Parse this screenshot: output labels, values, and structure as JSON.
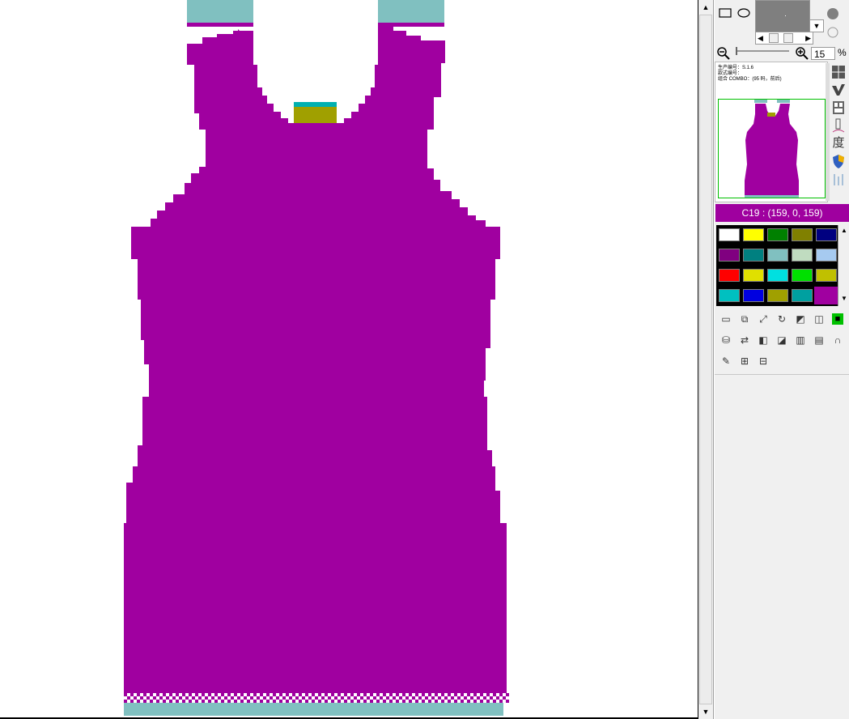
{
  "status": {
    "color_readout": "C19 : (159, 0, 159)"
  },
  "zoom": {
    "value": "15",
    "unit": "%"
  },
  "thumbnail": {
    "info_lines": [
      "生产编号：S.1.6",
      "款式编号：",
      "组合  COMBO：(95 码，前后)"
    ]
  },
  "colors": {
    "garment": "#a000a0",
    "collar_band": "#80c0c0",
    "hem_band": "#80c0c0",
    "neck_label_top": "#00b0b0",
    "neck_label": "#a0a000",
    "selected_color": "#9f009f"
  },
  "palette": [
    "#ffffff",
    "#ffff00",
    "#008000",
    "#808000",
    "#000080",
    "#800080",
    "#008080",
    "#80c0c0",
    "#c0dcc0",
    "#a6caf0",
    "#ff0000",
    "#e0e000",
    "#00e0e0",
    "#00e000",
    "#c0c000",
    "#00c0c0",
    "#0000e0",
    "#a0a000",
    "#00a0a0",
    "#a000a0"
  ],
  "side_tools": [
    "grid-icon",
    "check-icon",
    "layout-icon",
    "pen-icon",
    "du-char",
    "shield-icon",
    "bars-icon"
  ],
  "side_du_char": "度",
  "tools": [
    "select-rect-icon",
    "copy-block-icon",
    "resize-icon",
    "rotate-360-icon",
    "mirror-icon",
    "split-view-icon",
    "black-fill-icon",
    "fill-bucket-icon",
    "swap-colors-icon",
    "flip-h-icon",
    "invert-icon",
    "gradient-icon",
    "chart-edit-icon",
    "arch-icon",
    "pen-tool-icon",
    "align-icon",
    "distribute-icon"
  ]
}
